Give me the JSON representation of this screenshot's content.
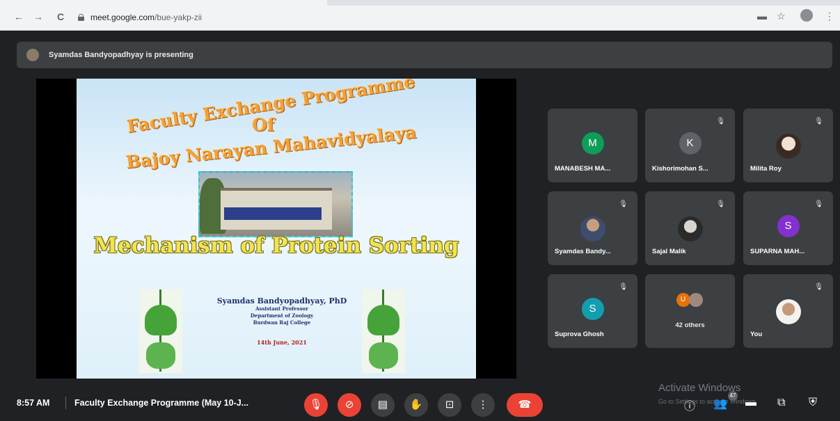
{
  "browser": {
    "url_host": "meet.google.com",
    "url_path": "/bue-yakp-zii",
    "back_icon": "←",
    "forward_icon": "→",
    "reload_icon": "C",
    "key_icon": "▬",
    "star_icon": "☆",
    "menu_icon": "⋮"
  },
  "banner": {
    "text": "Syamdas Bandyopadhyay is presenting"
  },
  "slide": {
    "line1": "Faculty Exchange Programme",
    "line2": "Of",
    "line3": "Bajoy Narayan Mahavidyalaya",
    "title": "Mechanism of Protein Sorting",
    "author_name": "Syamdas Bandyopadhyay, PhD",
    "author_role": "Assistant Professor",
    "author_dept": "Department of Zoology",
    "author_college": "Burdwan Raj College",
    "date": "14th June, 2021"
  },
  "participants": [
    {
      "name": "MANABESH MA...",
      "initial": "M",
      "color": "#0f9d58",
      "muted": false
    },
    {
      "name": "Kishorimohan S...",
      "initial": "K",
      "color": "#5f6368",
      "muted": true
    },
    {
      "name": "Milita Roy",
      "initial": "",
      "color": "#e8d9cf",
      "muted": true
    },
    {
      "name": "Syamdas Bandy...",
      "initial": "",
      "color": "#7a6b5e",
      "muted": true
    },
    {
      "name": "Sajal Malik",
      "initial": "",
      "color": "#b8b4ae",
      "muted": true
    },
    {
      "name": "SUPARNA MAH...",
      "initial": "S",
      "color": "#8430ce",
      "muted": true
    },
    {
      "name": "Suprova Ghosh",
      "initial": "S",
      "color": "#129eaf",
      "muted": true
    },
    {
      "name": "You",
      "initial": "",
      "color": "#d9d6d2",
      "muted": true
    }
  ],
  "others": {
    "label": "42 others",
    "first_initial": "U",
    "first_color": "#e8710a",
    "second_color": "#a1887f"
  },
  "bottom": {
    "time": "8:57 AM",
    "meeting_title": "Faculty Exchange Programme (May 10-J...",
    "people_count": "47"
  },
  "watermark": {
    "title": "Activate Windows",
    "subtitle": "Go to Settings to activate Windows."
  },
  "icons": {
    "mic_off": "🎙",
    "cam_off": "⊘",
    "captions": "▤",
    "hand": "✋",
    "present": "⊡",
    "more": "⋮",
    "end_call": "☎",
    "info": "ⓘ",
    "people": "👥",
    "chat": "▬",
    "activities": "⧉",
    "lock": "⛨",
    "muted": "🎙"
  }
}
